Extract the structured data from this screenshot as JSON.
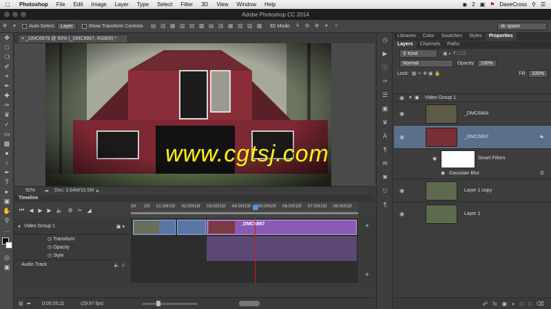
{
  "menubar": {
    "app_name": "Photoshop",
    "items": [
      "File",
      "Edit",
      "Image",
      "Layer",
      "Type",
      "Select",
      "Filter",
      "3D",
      "View",
      "Window",
      "Help"
    ],
    "badge_count": "2",
    "user": "DaveCross"
  },
  "window": {
    "title": "Adobe Photoshop CC 2014"
  },
  "options_bar": {
    "auto_select_label": "Auto-Select:",
    "auto_select_value": "Layer",
    "transform_label": "Show Transform Controls",
    "mode_3d_label": "3D Mode:",
    "workspace_value": "dc space"
  },
  "document": {
    "tab_label": "_DMC6879 @ 50% (_DMC6867, RGB/8) *",
    "zoom": "50%",
    "doc_size": "Doc: 2.64M/10.5M"
  },
  "timeline": {
    "title": "Timeline",
    "ruler_ticks": [
      "00",
      "15f",
      "01:00f",
      "15f",
      "02:00f",
      "15f",
      "03:00f",
      "15f",
      "04:00f",
      "15f",
      "05:00f",
      "15f",
      "06:00f",
      "15f",
      "07:00f",
      "15f",
      "08:00f",
      "15f"
    ],
    "group_label": "Video Group 1",
    "props": [
      "Transform",
      "Opacity",
      "Style"
    ],
    "audio_label": "Audio Track",
    "clip_label": "_DMC6867",
    "timecode": "0;00;05;11",
    "fps": "(29.97 fps)"
  },
  "panels": {
    "top_tabs": [
      "Libraries",
      "Color",
      "Swatches",
      "Styles",
      "Properties"
    ],
    "sub_tabs": [
      "Layers",
      "Channels",
      "Paths"
    ],
    "kind_filter": "Kind",
    "blend_mode": "Normal",
    "opacity_label": "Opacity:",
    "opacity_value": "100%",
    "lock_label": "Lock:",
    "fill_label": "Fill:",
    "fill_value": "100%"
  },
  "layers": {
    "group": "Video Group 1",
    "items": [
      {
        "name": "_DMC6864"
      },
      {
        "name": "_DMC6867"
      },
      {
        "name": "Smart Filters"
      },
      {
        "name": "Gaussian Blur"
      },
      {
        "name": "Layer 1 copy"
      },
      {
        "name": "Layer 1"
      }
    ]
  },
  "watermark": "www.cgtsj.com",
  "colors": {
    "accent_purple": "#8a5bb4",
    "accent_blue": "#5a76a8",
    "playhead": "#d02020",
    "selected_layer": "#5a6f8a"
  }
}
